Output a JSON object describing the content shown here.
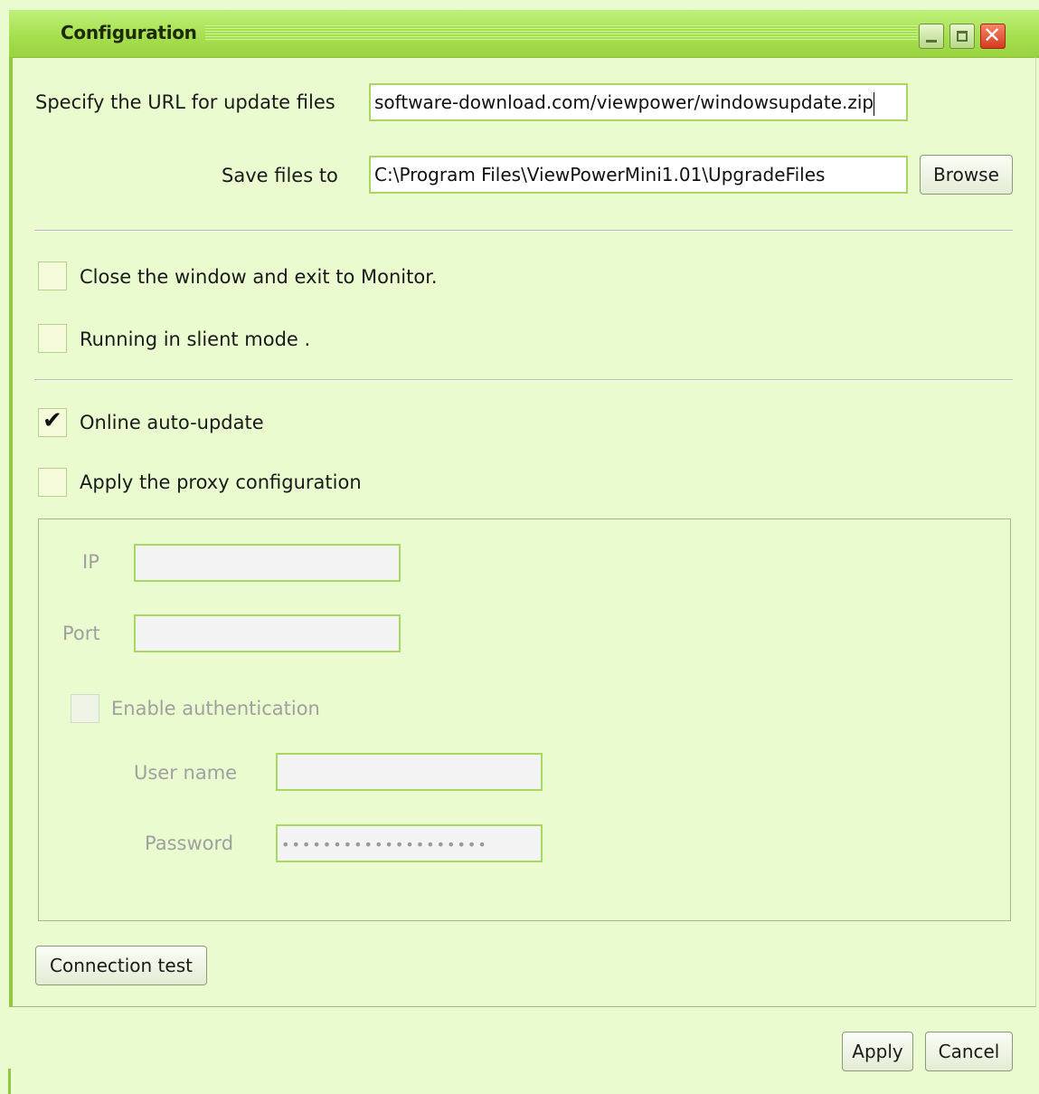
{
  "window": {
    "title": "Configuration",
    "controls": {
      "minimize": "minimize-icon",
      "maximize": "maximize-icon",
      "close": "close-icon"
    }
  },
  "update": {
    "url_label": "Specify the URL for update files",
    "url_value": "software-download.com/viewpower/windowsupdate.zip",
    "save_label": "Save files to",
    "save_value": "C:\\Program Files\\ViewPowerMini1.01\\UpgradeFiles",
    "browse_label": "Browse"
  },
  "options": {
    "close_window": {
      "label": "Close the window and exit to Monitor.",
      "checked": false
    },
    "silent_mode": {
      "label": "Running in slient mode .",
      "checked": false
    },
    "auto_update": {
      "label": "Online auto-update",
      "checked": true
    },
    "proxy": {
      "label": "Apply the proxy configuration",
      "checked": false
    }
  },
  "proxy": {
    "ip_label": "IP",
    "ip_value": "",
    "port_label": "Port",
    "port_value": "",
    "auth_label": "Enable authentication",
    "auth_checked": false,
    "username_label": "User name",
    "username_value": "",
    "password_label": "Password",
    "password_mask": "••••••••••••••••••••"
  },
  "buttons": {
    "connection_test": "Connection test",
    "apply": "Apply",
    "cancel": "Cancel"
  },
  "colors": {
    "background": "#eafbcf",
    "titlebar": "#a7e04f",
    "field_border": "#a8d860",
    "close_button": "#d63a1c"
  }
}
